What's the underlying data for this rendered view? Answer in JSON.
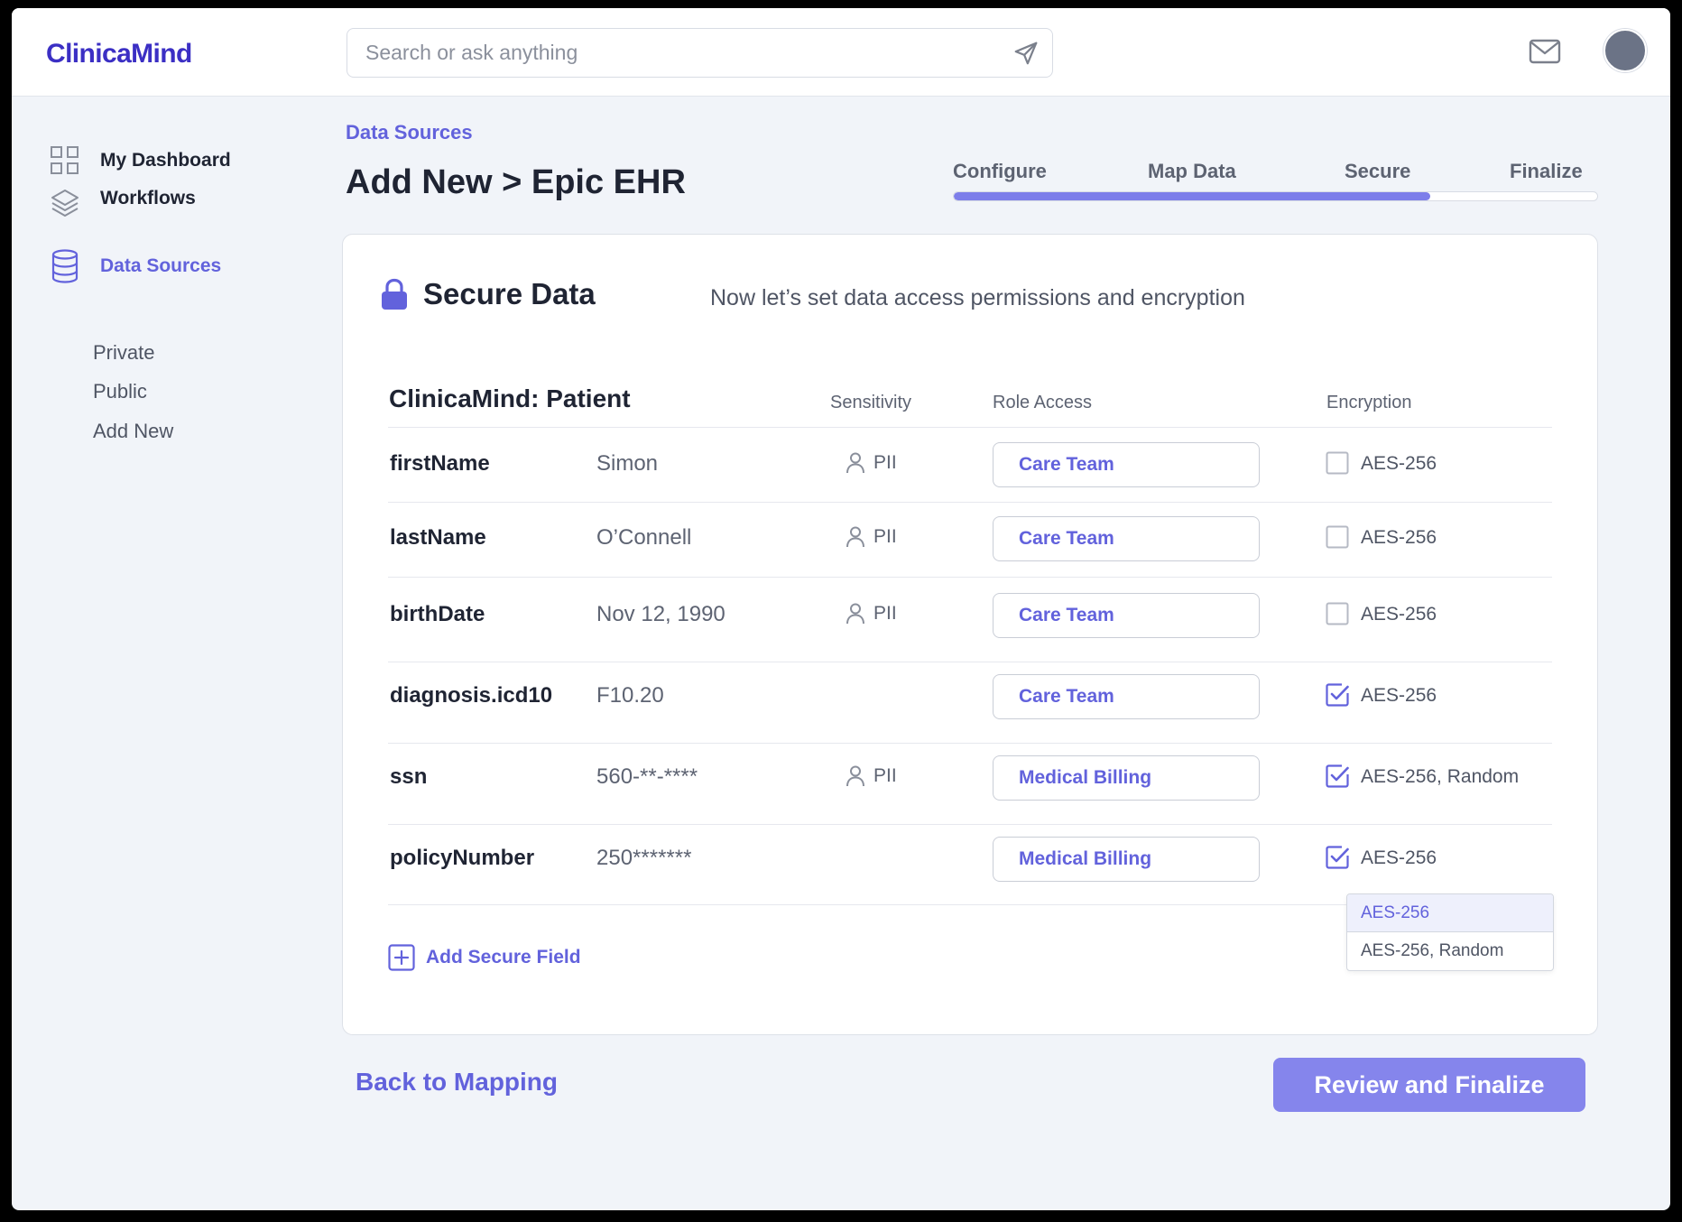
{
  "app": {
    "logo": "ClinicaMind"
  },
  "search": {
    "placeholder": "Search or ask anything"
  },
  "sidebar": {
    "items": [
      {
        "label": "My Dashboard",
        "icon": "grid-icon"
      },
      {
        "label": "Workflows",
        "icon": "layers-icon"
      },
      {
        "label": "Data Sources",
        "icon": "database-icon",
        "active": true
      }
    ],
    "subitems": [
      "Private",
      "Public",
      "Add New"
    ]
  },
  "page": {
    "breadcrumb": "Data Sources",
    "title": "Add New > Epic EHR"
  },
  "stepper": {
    "steps": [
      "Configure",
      "Map Data",
      "Secure",
      "Finalize"
    ],
    "progress": 0.74
  },
  "card": {
    "title": "Secure Data",
    "subtitle": "Now let’s set data access permissions and encryption",
    "table_title": "ClinicaMind: Patient",
    "columns": {
      "sensitivity": "Sensitivity",
      "role": "Role Access",
      "encryption": "Encryption"
    },
    "rows": [
      {
        "field": "firstName",
        "value": "Simon",
        "sensitivity": "PII",
        "role": "Care Team",
        "encrypted": false,
        "encryption": "AES-256"
      },
      {
        "field": "lastName",
        "value": "O’Connell",
        "sensitivity": "PII",
        "role": "Care Team",
        "encrypted": false,
        "encryption": "AES-256"
      },
      {
        "field": "birthDate",
        "value": "Nov 12, 1990",
        "sensitivity": "PII",
        "role": "Care Team",
        "encrypted": false,
        "encryption": "AES-256"
      },
      {
        "field": "diagnosis.icd10",
        "value": "F10.20",
        "sensitivity": "",
        "role": "Care Team",
        "encrypted": true,
        "encryption": "AES-256"
      },
      {
        "field": "ssn",
        "value": "560-**-****",
        "sensitivity": "PII",
        "role": "Medical Billing",
        "encrypted": true,
        "encryption": "AES-256, Random"
      },
      {
        "field": "policyNumber",
        "value": "250*******",
        "sensitivity": "",
        "role": "Medical Billing",
        "encrypted": true,
        "encryption": "AES-256"
      }
    ],
    "dropdown": {
      "options": [
        "AES-256",
        "AES-256, Random"
      ],
      "selected": "AES-256"
    },
    "add_field_label": "Add Secure Field"
  },
  "footer": {
    "back_label": "Back to Mapping",
    "next_label": "Review and Finalize"
  },
  "colors": {
    "accent": "#6262dc",
    "logo": "#3b2fc4",
    "primary_button": "#8585ec",
    "background": "#f1f4f9"
  }
}
